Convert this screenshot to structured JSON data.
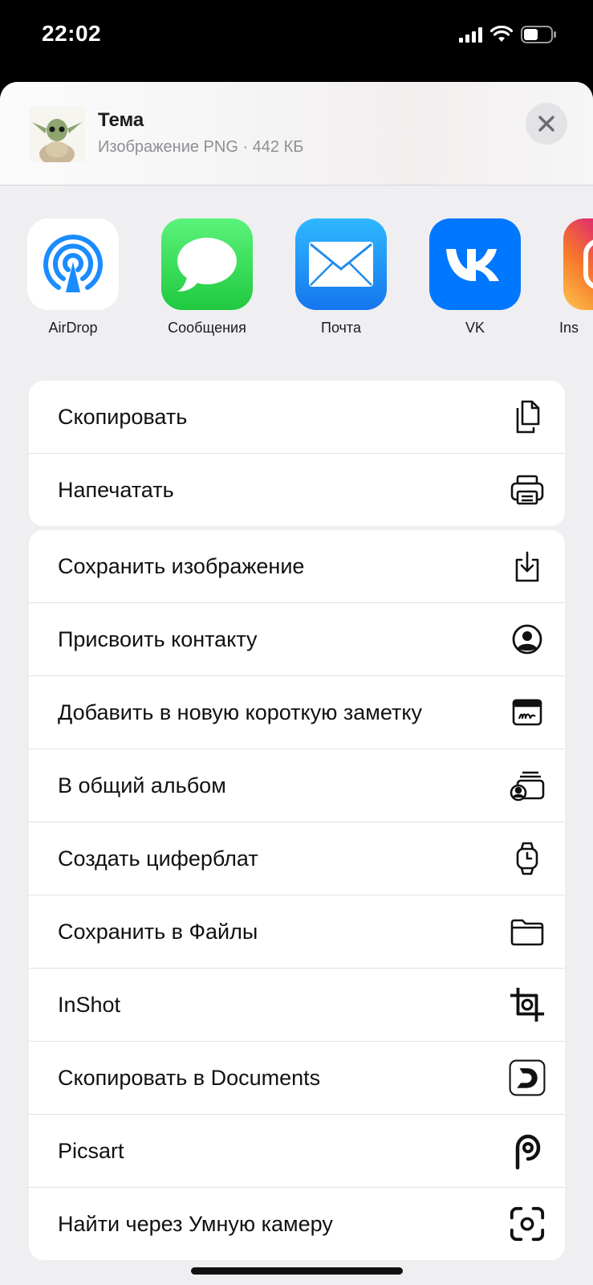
{
  "status_bar": {
    "time": "22:02"
  },
  "share_sheet": {
    "file": {
      "title": "Тема",
      "meta": "Изображение PNG · 442 КБ"
    },
    "apps": [
      {
        "label": "AirDrop",
        "icon": "airdrop-icon"
      },
      {
        "label": "Сообщения",
        "icon": "messages-icon"
      },
      {
        "label": "Почта",
        "icon": "mail-icon"
      },
      {
        "label": "VK",
        "icon": "vk-icon"
      },
      {
        "label": "Ins",
        "icon": "instagram-icon"
      }
    ],
    "group1": [
      {
        "label": "Скопировать",
        "icon": "copy-icon"
      },
      {
        "label": "Напечатать",
        "icon": "printer-icon"
      }
    ],
    "group2": [
      {
        "label": "Сохранить изображение",
        "icon": "save-download-icon"
      },
      {
        "label": "Присвоить контакту",
        "icon": "contact-icon"
      },
      {
        "label": "Добавить в новую короткую заметку",
        "icon": "quick-note-icon"
      },
      {
        "label": "В общий альбом",
        "icon": "shared-album-icon"
      },
      {
        "label": "Создать циферблат",
        "icon": "watch-icon"
      },
      {
        "label": "Сохранить в Файлы",
        "icon": "folder-icon"
      },
      {
        "label": "InShot",
        "icon": "inshot-icon"
      },
      {
        "label": "Скопировать в Documents",
        "icon": "documents-icon"
      },
      {
        "label": "Picsart",
        "icon": "picsart-icon"
      },
      {
        "label": "Найти через Умную камеру",
        "icon": "smart-camera-icon"
      }
    ]
  },
  "colors": {
    "messages_green": "#34c759",
    "mail_blue": "#1b8ef0",
    "vk_blue": "#0077ff",
    "airdrop_blue": "#1a8cff"
  }
}
